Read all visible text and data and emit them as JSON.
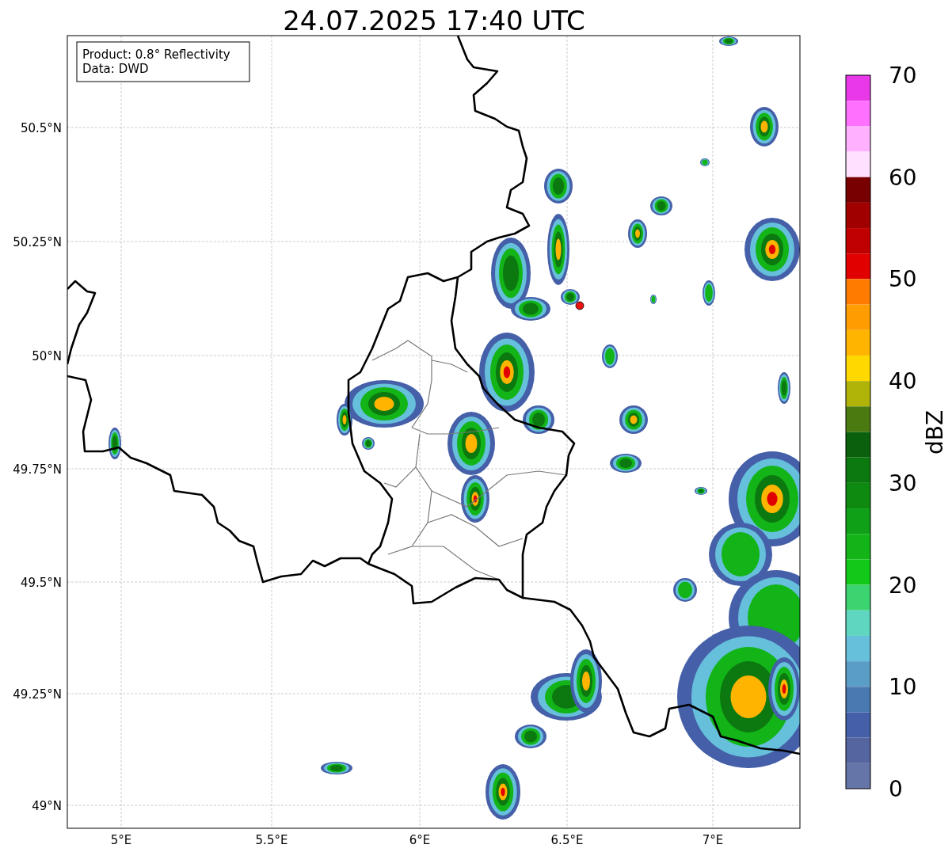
{
  "title": "24.07.2025 17:40 UTC",
  "legend": [
    "Product: 0.8° Reflectivity",
    "Data: DWD"
  ],
  "lat_ticks": [
    "50.5°N",
    "50.25°N",
    "50°N",
    "49.75°N",
    "49.5°N",
    "49.25°N",
    "49°N"
  ],
  "lon_ticks": [
    "5°E",
    "5.5°E",
    "6°E",
    "6.5°E",
    "7°E"
  ],
  "colorbar": {
    "label": "dBZ",
    "ticks": [
      "70",
      "60",
      "50",
      "40",
      "30",
      "20",
      "10",
      "0"
    ],
    "segments": [
      {
        "color": "#e838e8"
      },
      {
        "color": "#ff70ff"
      },
      {
        "color": "#ffb0ff"
      },
      {
        "color": "#ffe0ff"
      },
      {
        "color": "#780000"
      },
      {
        "color": "#a00000"
      },
      {
        "color": "#c00000"
      },
      {
        "color": "#e00000"
      },
      {
        "color": "#ff7c00"
      },
      {
        "color": "#ff9c00"
      },
      {
        "color": "#ffb400"
      },
      {
        "color": "#ffd800"
      },
      {
        "color": "#b0b408"
      },
      {
        "color": "#4a7a10"
      },
      {
        "color": "#0a600c"
      },
      {
        "color": "#0c7810"
      },
      {
        "color": "#0e8a10"
      },
      {
        "color": "#10a018"
      },
      {
        "color": "#12b418"
      },
      {
        "color": "#12c818"
      },
      {
        "color": "#3cd470"
      },
      {
        "color": "#5ed6c0"
      },
      {
        "color": "#66c0dc"
      },
      {
        "color": "#5a9ec8"
      },
      {
        "color": "#4a78b0"
      },
      {
        "color": "#4560a8"
      },
      {
        "color": "#5465a0"
      },
      {
        "color": "#6675a8"
      }
    ]
  }
}
